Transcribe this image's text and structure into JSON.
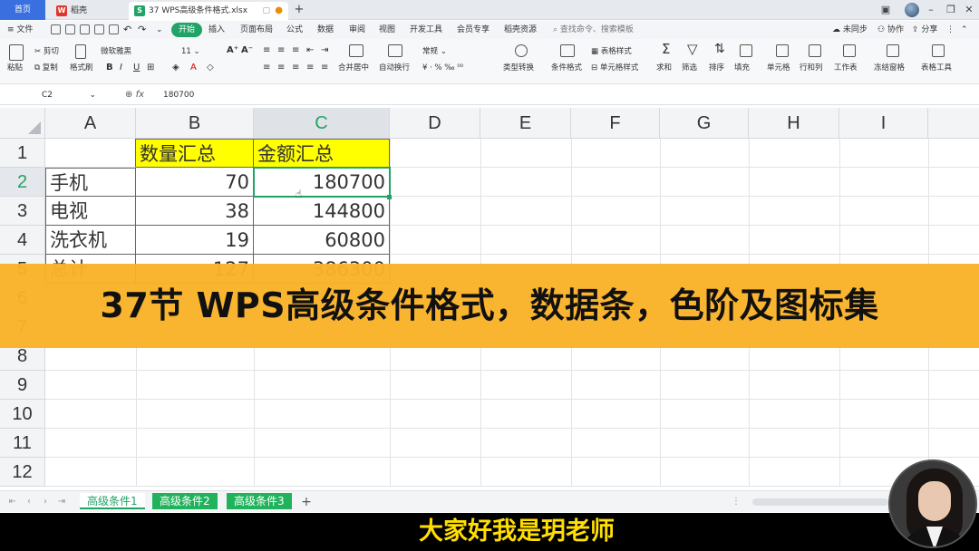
{
  "titlebar": {
    "home_tab": "首页",
    "daoke_tab": "稻壳",
    "file_tab": "37 WPS高级条件格式.xlsx",
    "daoke_icon": "daoke-icon",
    "sheet_icon_letter": "S"
  },
  "menubar": {
    "file": "文件",
    "items": [
      "开始",
      "插入",
      "页面布局",
      "公式",
      "数据",
      "审阅",
      "视图",
      "开发工具",
      "会员专享",
      "稻壳资源"
    ],
    "search_placeholder": "查找命令、搜索模板",
    "sync": "未同步",
    "collab": "协作",
    "share": "分享"
  },
  "ribbon": {
    "paste": "粘贴",
    "cut": "剪切",
    "copy": "复制",
    "format_painter": "格式刷",
    "font_name": "微软雅黑",
    "font_size": "11",
    "merge": "合并居中",
    "wrap": "自动换行",
    "number_format": "常规",
    "type_convert": "类型转换",
    "cond_format": "条件格式",
    "table_style": "表格样式",
    "cell_style": "单元格样式",
    "sum": "求和",
    "filter": "筛选",
    "sort": "排序",
    "fill": "填充",
    "cell": "单元格",
    "row_col": "行和列",
    "worksheet": "工作表",
    "freeze": "冻结窗格",
    "table_tools": "表格工具"
  },
  "formulabar": {
    "cell_ref": "C2",
    "fx": "fx",
    "value": "180700"
  },
  "grid": {
    "columns": [
      "A",
      "B",
      "C",
      "D",
      "E",
      "F",
      "G",
      "H",
      "I"
    ],
    "rows": [
      "1",
      "2",
      "3",
      "4",
      "5",
      "6",
      "7",
      "8",
      "9",
      "10",
      "11",
      "12"
    ],
    "headers": {
      "b1": "数量汇总",
      "c1": "金额汇总"
    },
    "data": [
      {
        "name": "手机",
        "qty": "70",
        "amount": "180700"
      },
      {
        "name": "电视",
        "qty": "38",
        "amount": "144800"
      },
      {
        "name": "洗衣机",
        "qty": "19",
        "amount": "60800"
      },
      {
        "name": "总计",
        "qty": "127",
        "amount": "386300"
      }
    ]
  },
  "banner": {
    "text": "37节 WPS高级条件格式，数据条，色阶及图标集"
  },
  "sheets": {
    "tabs": [
      "高级条件1",
      "高级条件2",
      "高级条件3"
    ],
    "add": "+"
  },
  "subtitle": {
    "text": "大家好我是玥老师"
  },
  "colors": {
    "accent": "#21a366",
    "banner": "#fab228",
    "highlight": "#ffff00",
    "subtitle": "#ffde00"
  }
}
